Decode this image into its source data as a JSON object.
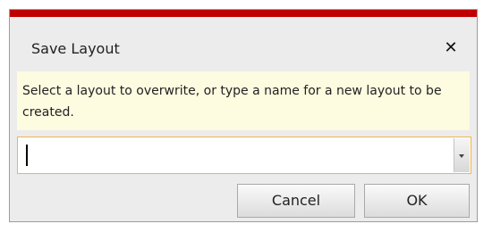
{
  "dialog": {
    "title": "Save Layout",
    "close_glyph": "✕",
    "message": "Select a layout to overwrite, or type a name for a new layout to be created.",
    "layout_name_value": "",
    "accent_color": "#c00000",
    "buttons": {
      "cancel_label": "Cancel",
      "ok_label": "OK"
    }
  }
}
